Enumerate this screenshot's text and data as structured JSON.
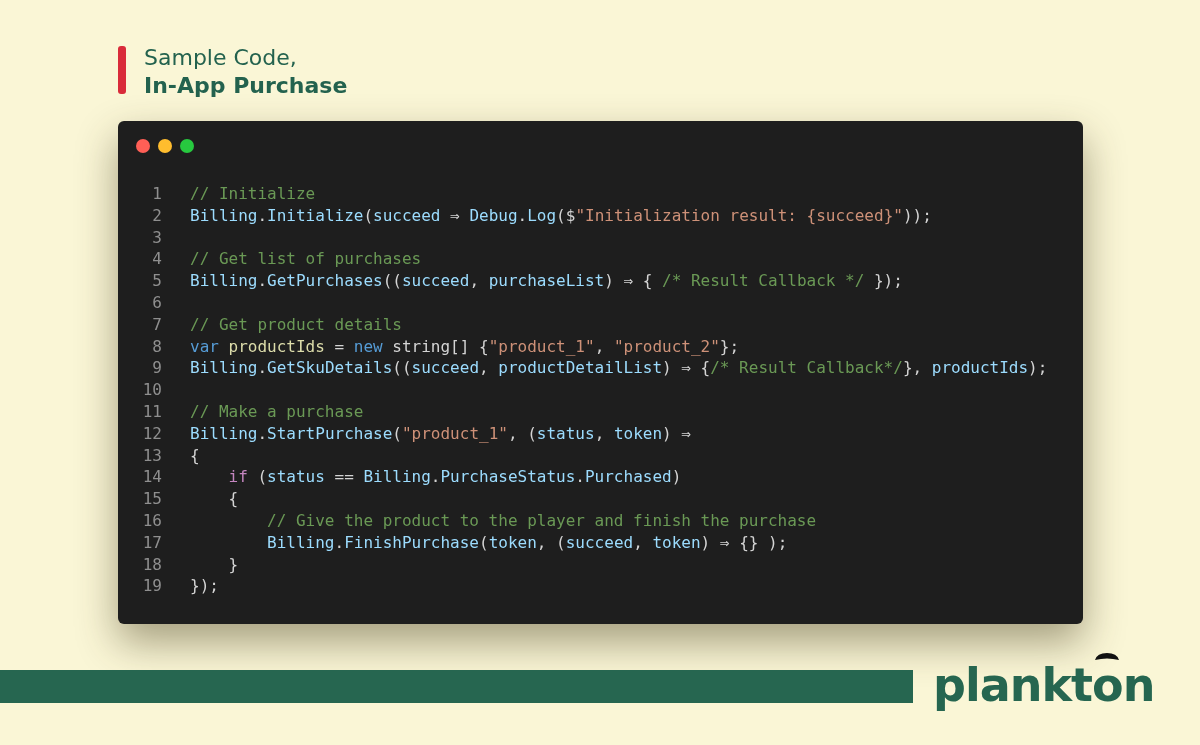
{
  "header": {
    "title": "Sample Code,",
    "subtitle": "In-App Purchase"
  },
  "code_window": {
    "lines": [
      {
        "number": "1",
        "tokens": [
          {
            "kind": "comment",
            "text": "// Initialize"
          }
        ]
      },
      {
        "number": "2",
        "tokens": [
          {
            "kind": "ident",
            "text": "Billing"
          },
          {
            "kind": "punct",
            "text": "."
          },
          {
            "kind": "ident",
            "text": "Initialize"
          },
          {
            "kind": "punct",
            "text": "("
          },
          {
            "kind": "ident",
            "text": "succeed"
          },
          {
            "kind": "punct",
            "text": " ⇒ "
          },
          {
            "kind": "ident",
            "text": "Debug"
          },
          {
            "kind": "punct",
            "text": "."
          },
          {
            "kind": "ident",
            "text": "Log"
          },
          {
            "kind": "punct",
            "text": "($"
          },
          {
            "kind": "string",
            "text": "\"Initialization result: {succeed}\""
          },
          {
            "kind": "punct",
            "text": "));"
          }
        ]
      },
      {
        "number": "3"
      },
      {
        "number": "4",
        "tokens": [
          {
            "kind": "comment",
            "text": "// Get list of purchases"
          }
        ]
      },
      {
        "number": "5",
        "tokens": [
          {
            "kind": "ident",
            "text": "Billing"
          },
          {
            "kind": "punct",
            "text": "."
          },
          {
            "kind": "ident",
            "text": "GetPurchases"
          },
          {
            "kind": "punct",
            "text": "(("
          },
          {
            "kind": "ident",
            "text": "succeed"
          },
          {
            "kind": "punct",
            "text": ", "
          },
          {
            "kind": "ident",
            "text": "purchaseList"
          },
          {
            "kind": "punct",
            "text": ") ⇒ { "
          },
          {
            "kind": "comment",
            "text": "/* Result Callback */"
          },
          {
            "kind": "punct",
            "text": " });"
          }
        ]
      },
      {
        "number": "6"
      },
      {
        "number": "7",
        "tokens": [
          {
            "kind": "comment",
            "text": "// Get product details"
          }
        ]
      },
      {
        "number": "8",
        "tokens": [
          {
            "kind": "storage",
            "text": "var"
          },
          {
            "kind": "variable",
            "text": " productIds"
          },
          {
            "kind": "punct",
            "text": " = "
          },
          {
            "kind": "storage",
            "text": "new"
          },
          {
            "kind": "punct",
            "text": " string[] {"
          },
          {
            "kind": "string",
            "text": "\"product_1\""
          },
          {
            "kind": "punct",
            "text": ", "
          },
          {
            "kind": "string",
            "text": "\"product_2\""
          },
          {
            "kind": "punct",
            "text": "};"
          }
        ]
      },
      {
        "number": "9",
        "tokens": [
          {
            "kind": "ident",
            "text": "Billing"
          },
          {
            "kind": "punct",
            "text": "."
          },
          {
            "kind": "ident",
            "text": "GetSkuDetails"
          },
          {
            "kind": "punct",
            "text": "(("
          },
          {
            "kind": "ident",
            "text": "succeed"
          },
          {
            "kind": "punct",
            "text": ", "
          },
          {
            "kind": "ident",
            "text": "productDetailList"
          },
          {
            "kind": "punct",
            "text": ") ⇒ {"
          },
          {
            "kind": "comment",
            "text": "/* Result Callback*/"
          },
          {
            "kind": "punct",
            "text": "}, "
          },
          {
            "kind": "ident",
            "text": "productIds"
          },
          {
            "kind": "punct",
            "text": ");"
          }
        ]
      },
      {
        "number": "10"
      },
      {
        "number": "11",
        "tokens": [
          {
            "kind": "comment",
            "text": "// Make a purchase"
          }
        ]
      },
      {
        "number": "12",
        "tokens": [
          {
            "kind": "ident",
            "text": "Billing"
          },
          {
            "kind": "punct",
            "text": "."
          },
          {
            "kind": "ident",
            "text": "StartPurchase"
          },
          {
            "kind": "punct",
            "text": "("
          },
          {
            "kind": "string",
            "text": "\"product_1\""
          },
          {
            "kind": "punct",
            "text": ", ("
          },
          {
            "kind": "ident",
            "text": "status"
          },
          {
            "kind": "punct",
            "text": ", "
          },
          {
            "kind": "ident",
            "text": "token"
          },
          {
            "kind": "punct",
            "text": ") ⇒"
          }
        ]
      },
      {
        "number": "13",
        "tokens": [
          {
            "kind": "punct",
            "text": "{"
          }
        ]
      },
      {
        "number": "14",
        "tokens": [
          {
            "kind": "keyword",
            "text": "    if"
          },
          {
            "kind": "punct",
            "text": " ("
          },
          {
            "kind": "ident",
            "text": "status"
          },
          {
            "kind": "punct",
            "text": " == "
          },
          {
            "kind": "ident",
            "text": "Billing"
          },
          {
            "kind": "punct",
            "text": "."
          },
          {
            "kind": "ident",
            "text": "PurchaseStatus"
          },
          {
            "kind": "punct",
            "text": "."
          },
          {
            "kind": "ident",
            "text": "Purchased"
          },
          {
            "kind": "punct",
            "text": ")"
          }
        ]
      },
      {
        "number": "15",
        "tokens": [
          {
            "kind": "punct",
            "text": "    {"
          }
        ]
      },
      {
        "number": "16",
        "tokens": [
          {
            "kind": "comment",
            "text": "        // Give the product to the player and finish the purchase"
          }
        ]
      },
      {
        "number": "17",
        "tokens": [
          {
            "kind": "ident",
            "text": "        Billing"
          },
          {
            "kind": "punct",
            "text": "."
          },
          {
            "kind": "ident",
            "text": "FinishPurchase"
          },
          {
            "kind": "punct",
            "text": "("
          },
          {
            "kind": "ident",
            "text": "token"
          },
          {
            "kind": "punct",
            "text": ", ("
          },
          {
            "kind": "ident",
            "text": "succeed"
          },
          {
            "kind": "punct",
            "text": ", "
          },
          {
            "kind": "ident",
            "text": "token"
          },
          {
            "kind": "punct",
            "text": ") ⇒ {} );"
          }
        ]
      },
      {
        "number": "18",
        "tokens": [
          {
            "kind": "punct",
            "text": "    }"
          }
        ]
      },
      {
        "number": "19",
        "tokens": [
          {
            "kind": "punct",
            "text": "});"
          }
        ]
      }
    ]
  },
  "footer": {
    "logo": "plankton"
  }
}
